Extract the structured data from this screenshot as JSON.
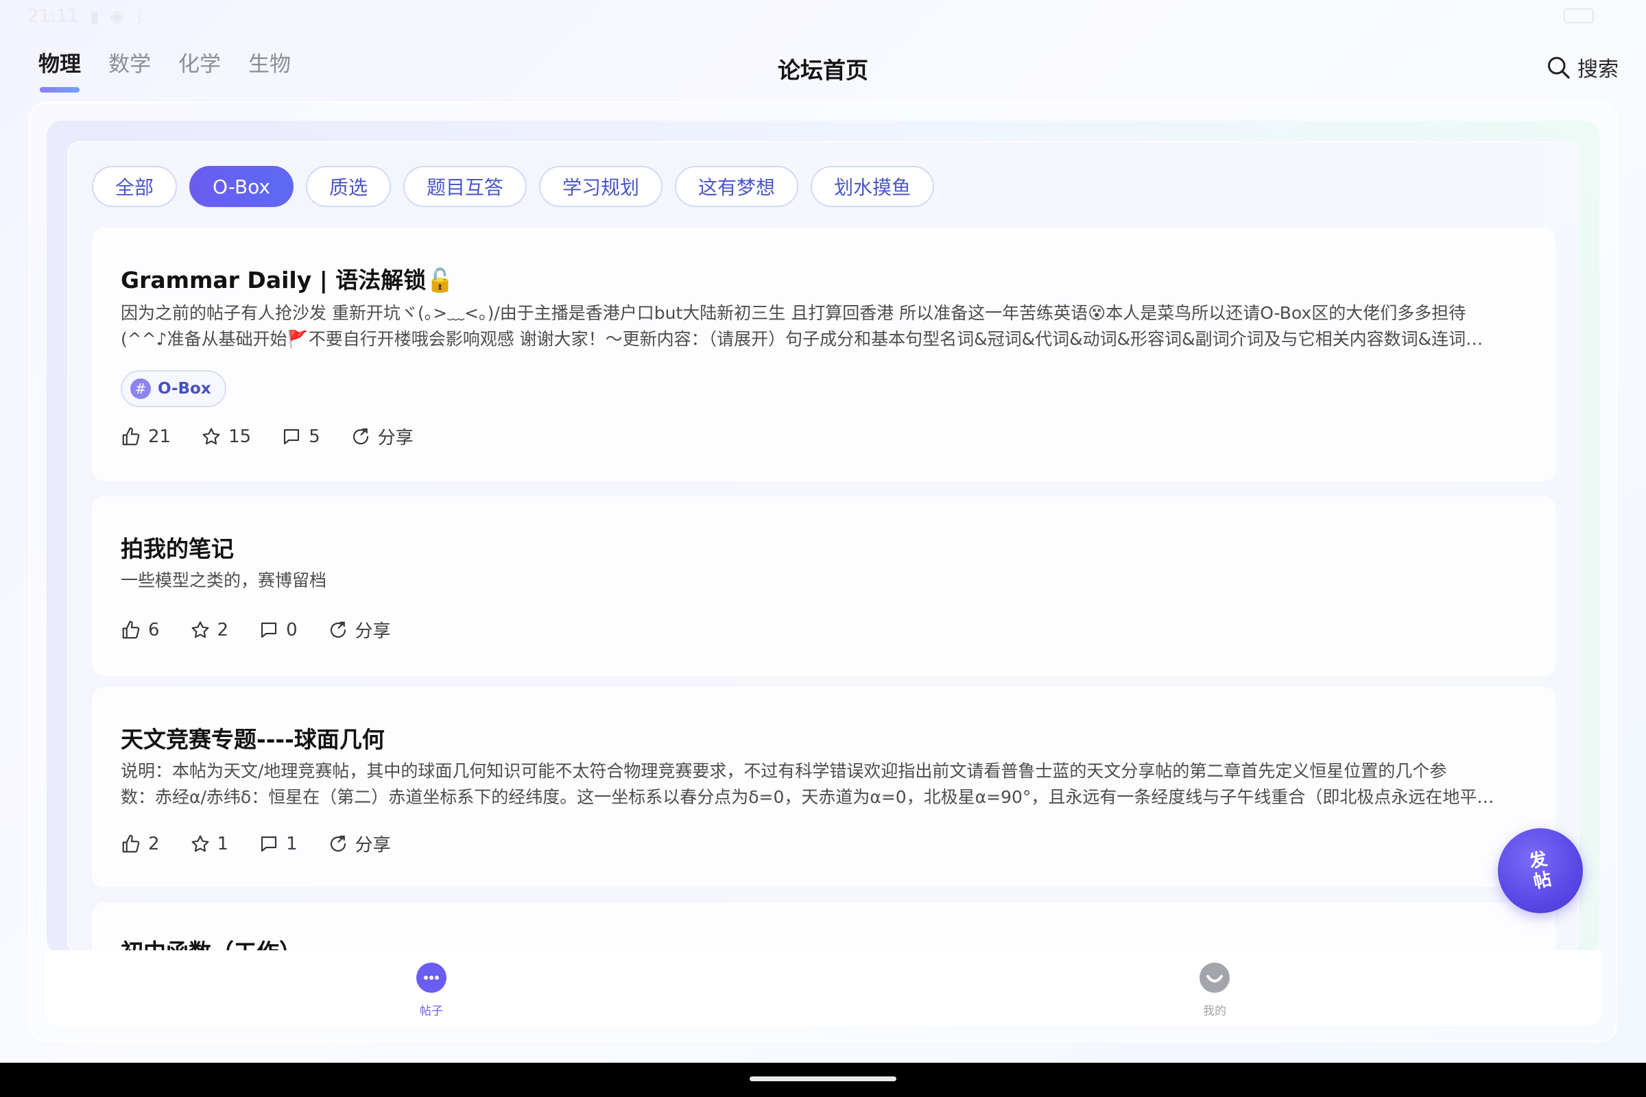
{
  "status_bar": {
    "time": "21:11"
  },
  "header": {
    "subject_tabs": [
      {
        "label": "物理",
        "active": true
      },
      {
        "label": "数学",
        "active": false
      },
      {
        "label": "化学",
        "active": false
      },
      {
        "label": "生物",
        "active": false
      }
    ],
    "title": "论坛首页",
    "search_label": "搜索"
  },
  "categories": [
    {
      "label": "全部",
      "active": false
    },
    {
      "label": "O-Box",
      "active": true
    },
    {
      "label": "质选",
      "active": false
    },
    {
      "label": "题目互答",
      "active": false
    },
    {
      "label": "学习规划",
      "active": false
    },
    {
      "label": "这有梦想",
      "active": false
    },
    {
      "label": "划水摸鱼",
      "active": false
    }
  ],
  "posts": [
    {
      "title": "Grammar Daily | 语法解锁🔓",
      "body_line1": "因为之前的帖子有人抢沙发 重新开坑ヾ(｡>﹏<｡)/由于主播是香港户口but大陆新初三生 且打算回香港 所以准备这一年苦练英语😵本人是菜鸟所以还请O-Box区的大佬们多多担待",
      "body_line2": "(^^♪准备从基础开始🚩不要自行开楼哦会影响观感 谢谢大家！～更新内容：（请展开）句子成分和基本句型名词&冠词&代词&动词&形容词&副词介词及与它相关内容数词&连词…",
      "tag": "O-Box",
      "likes": "21",
      "stars": "15",
      "comments": "5",
      "share": "分享"
    },
    {
      "title": "拍我的笔记",
      "body_line1": "一些模型之类的，赛博留档",
      "likes": "6",
      "stars": "2",
      "comments": "0",
      "share": "分享"
    },
    {
      "title": "天文竞赛专题----球面几何",
      "body_line1": "说明：本帖为天文/地理竞赛帖，其中的球面几何知识可能不太符合物理竞赛要求，不过有科学错误欢迎指出前文请看普鲁士蓝的天文分享帖的第二章首先定义恒星位置的几个参",
      "body_line2": "数：赤经α/赤纬δ：恒星在（第二）赤道坐标系下的经纬度。这一坐标系以春分点为δ=0，天赤道为α=0，北极星α=90°，且永远有一条经度线与子午线重合（即北极点永远在地平…",
      "likes": "2",
      "stars": "1",
      "comments": "1",
      "share": "分享"
    },
    {
      "title": "初中函数（工作）"
    }
  ],
  "fab": {
    "label": "发帖"
  },
  "bottom_nav": [
    {
      "label": "帖子",
      "active": true,
      "icon": "chat-bubble-icon"
    },
    {
      "label": "我的",
      "active": false,
      "icon": "profile-icon"
    }
  ],
  "colors": {
    "accent": "#6A5CF0",
    "tag_text": "#4650BD",
    "active_nav": "#6B5CF2",
    "inactive_nav": "#A0A0A8"
  }
}
